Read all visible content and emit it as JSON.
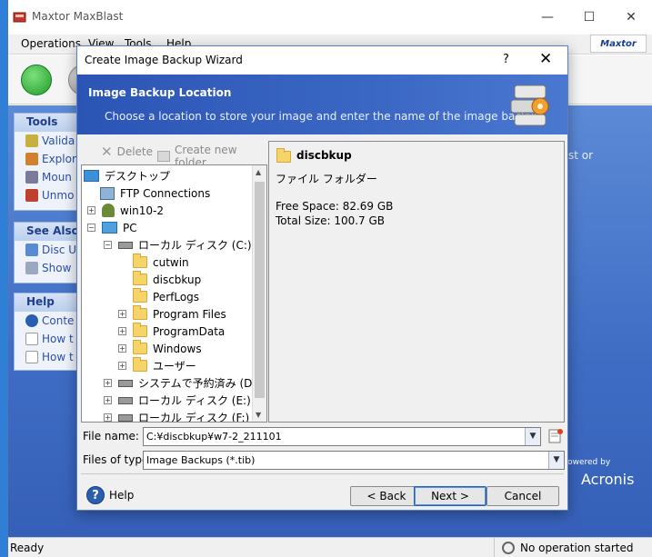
{
  "app": {
    "title": "Maxtor MaxBlast",
    "menu": [
      "Operations",
      "View",
      "Tools",
      "Help"
    ],
    "brand": "Maxtor",
    "window_controls": [
      "—",
      "☐",
      "✕"
    ]
  },
  "sidebar": {
    "tools": {
      "title": "Tools",
      "items": [
        "Valida",
        "Explor",
        "Moun",
        "Unmo"
      ]
    },
    "see_also": {
      "title": "See Also",
      "items": [
        "Disc U",
        "Show"
      ]
    },
    "help": {
      "title": "Help",
      "items": [
        "Conte",
        "How t",
        "How t"
      ]
    }
  },
  "main_text_fragment": "st or",
  "powered_by": {
    "line1": "Powered by",
    "line2": "Acronis"
  },
  "status": {
    "ready": "Ready",
    "operation": "No operation started"
  },
  "dialog": {
    "title": "Create Image Backup Wizard",
    "help_btn": "?",
    "close_btn": "✕",
    "banner_title": "Image Backup Location",
    "banner_subtitle": "Choose a location to store your image and enter the name of the image backup.",
    "toolbar": {
      "delete": "Delete",
      "new_folder": "Create new folder"
    },
    "tree": [
      {
        "label": "デスクトップ",
        "icon": "desktop-icon",
        "expander": ""
      },
      {
        "label": "FTP Connections",
        "icon": "network-icon",
        "expander": ""
      },
      {
        "label": "win10-2",
        "icon": "user-icon",
        "expander": "+"
      },
      {
        "label": "PC",
        "icon": "computer-icon",
        "expander": "-"
      },
      {
        "label": "ローカル ディスク (C:)",
        "icon": "drive-icon",
        "expander": "-"
      },
      {
        "label": "cutwin",
        "icon": "folder-icon",
        "expander": ""
      },
      {
        "label": "discbkup",
        "icon": "folder-icon",
        "expander": ""
      },
      {
        "label": "PerfLogs",
        "icon": "folder-icon",
        "expander": ""
      },
      {
        "label": "Program Files",
        "icon": "folder-icon",
        "expander": "+"
      },
      {
        "label": "ProgramData",
        "icon": "folder-icon",
        "expander": "+"
      },
      {
        "label": "Windows",
        "icon": "folder-icon",
        "expander": "+"
      },
      {
        "label": "ユーザー",
        "icon": "folder-icon",
        "expander": "+"
      },
      {
        "label": "システムで予約済み (D:)",
        "icon": "drive-icon",
        "expander": "+"
      },
      {
        "label": "ローカル ディスク (E:)",
        "icon": "drive-icon",
        "expander": "+"
      },
      {
        "label": "ローカル ディスク (F:)",
        "icon": "drive-icon",
        "expander": "+"
      }
    ],
    "details": {
      "name": "discbkup",
      "type": "ファイル フォルダー",
      "free_space": "Free Space: 82.69 GB",
      "total_size": "Total Size: 100.7 GB"
    },
    "file_name_label": "File name:",
    "file_name_value": "C:¥discbkup¥w7-2_211101",
    "file_type_label": "Files of type:",
    "file_type_value": "Image Backups (*.tib)",
    "help_label": "Help",
    "buttons": {
      "back": "< Back",
      "next": "Next >",
      "cancel": "Cancel"
    }
  }
}
